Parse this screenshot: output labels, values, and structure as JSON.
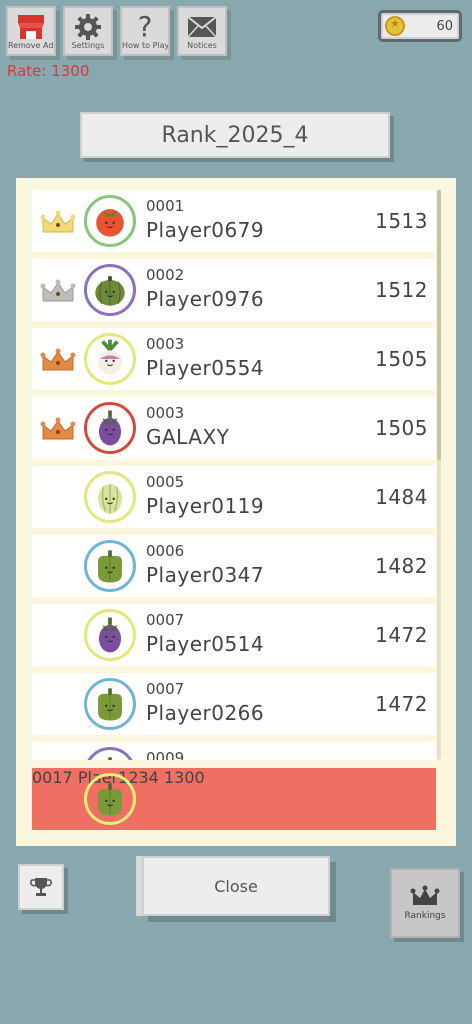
{
  "top_buttons": [
    {
      "label": "Remove Ads",
      "icon": "shop-icon"
    },
    {
      "label": "Settings",
      "icon": "gear-icon"
    },
    {
      "label": "How to Play",
      "icon": "question-icon"
    },
    {
      "label": "Notices",
      "icon": "envelope-icon"
    }
  ],
  "coins": "60",
  "rate": "Rate: 1300",
  "title": "Rank_2025_4",
  "rows": [
    {
      "rank": "0001",
      "name": "Player0679",
      "score": "1513",
      "crown": "gold",
      "veg": "tomato",
      "ring": "#86c77a"
    },
    {
      "rank": "0002",
      "name": "Player0976",
      "score": "1512",
      "crown": "silver",
      "veg": "pumpkin",
      "ring": "#8b6fc2"
    },
    {
      "rank": "0003",
      "name": "Player0554",
      "score": "1505",
      "crown": "bronze",
      "veg": "turnip",
      "ring": "#e3e87a"
    },
    {
      "rank": "0003",
      "name": "GALAXY",
      "score": "1505",
      "crown": "bronze",
      "veg": "eggplant",
      "ring": "#d24a3a"
    },
    {
      "rank": "0005",
      "name": "Player0119",
      "score": "1484",
      "crown": "",
      "veg": "cabbage",
      "ring": "#e3e87a"
    },
    {
      "rank": "0006",
      "name": "Player0347",
      "score": "1482",
      "crown": "",
      "veg": "pepper",
      "ring": "#6fb6d6"
    },
    {
      "rank": "0007",
      "name": "Player0514",
      "score": "1472",
      "crown": "",
      "veg": "eggplant",
      "ring": "#e3e87a"
    },
    {
      "rank": "0007",
      "name": "Player0266",
      "score": "1472",
      "crown": "",
      "veg": "pepper",
      "ring": "#6fb6d6"
    },
    {
      "rank": "0009",
      "name": "",
      "score": "",
      "crown": "",
      "veg": "pepper",
      "ring": "#8b6fc2"
    }
  ],
  "me": {
    "rank": "0017",
    "name": "Plaer1234",
    "score": "1300",
    "veg": "pepper",
    "ring": "#e9ee7a"
  },
  "close_label": "Close",
  "rankings_label": "Rankings",
  "colors": {
    "background": "#89a8ad",
    "panel": "#fbf6de",
    "highlight": "#ef6f62",
    "rate_text": "#d63a3a"
  }
}
